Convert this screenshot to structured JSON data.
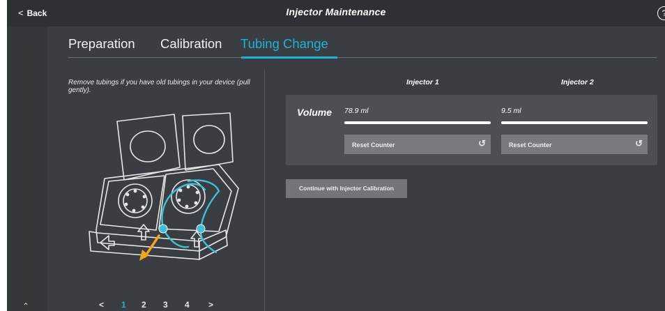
{
  "header": {
    "back_label": "Back",
    "title": "Injector Maintenance",
    "help_symbol": "?"
  },
  "tabs": [
    {
      "label": "Preparation",
      "active": false
    },
    {
      "label": "Calibration",
      "active": false
    },
    {
      "label": "Tubing Change",
      "active": true
    }
  ],
  "instruction": "Remove tubings if you have old tubings in your device (pull gently).",
  "pager": {
    "prev_symbol": "<",
    "next_symbol": ">",
    "pages": [
      "1",
      "2",
      "3",
      "4"
    ],
    "current": 1
  },
  "table": {
    "row_label": "Volume",
    "injectors": [
      {
        "name": "Injector 1",
        "volume": "78.9 ml",
        "reset_label": "Reset Counter"
      },
      {
        "name": "Injector 2",
        "volume": "9.5 ml",
        "reset_label": "Reset Counter"
      }
    ]
  },
  "continue_label": "Continue with Injector Calibration",
  "colors": {
    "accent": "#1fb2d7",
    "arrow": "#f2a51c",
    "background": "#3a3e42",
    "panel": "#4c5054",
    "button": "#777b80"
  }
}
